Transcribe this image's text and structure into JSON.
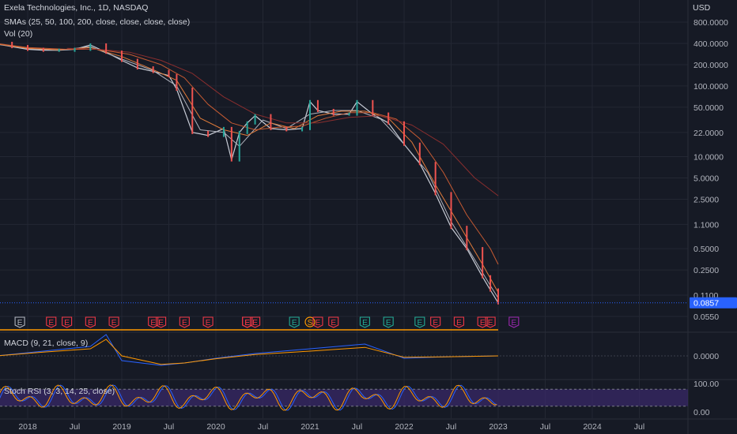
{
  "header": {
    "title": "Exela Technologies, Inc., 1D, NASDAQ",
    "sma_legend": "SMAs (25, 50, 100, 200, close, close, close, close)",
    "vol_legend": "Vol (20)",
    "currency": "USD"
  },
  "colors": {
    "background": "#161a25",
    "grid": "#232733",
    "price_line": "#c8ccd6",
    "sma25": "#b0b3bd",
    "sma50": "#e07b3a",
    "sma100": "#c55a32",
    "sma200": "#8a2e2e",
    "up_candle": "#26a69a",
    "down_candle": "#ef5350",
    "macd_line": "#2962ff",
    "signal_line": "#ff9800",
    "stoch_k": "#2962ff",
    "stoch_d": "#ff9800",
    "stoch_band": "#3b2a6b",
    "earnings_red": "#f23645",
    "earnings_green": "#22ab94",
    "earnings_orange": "#ff9800",
    "earnings_purple": "#9c27b0",
    "current_price_tag": "#2962ff"
  },
  "chart_data": [
    {
      "type": "line",
      "panel": "price",
      "title": "Exela Technologies, Inc., 1D, NASDAQ",
      "scale": "log",
      "ylabel": "USD",
      "y_ticks": [
        800,
        400,
        200,
        100,
        50,
        22,
        10,
        5,
        2.5,
        1.1,
        0.5,
        0.25,
        0.11,
        0.055
      ],
      "y_tick_labels": [
        "800.0000",
        "400.0000",
        "200.0000",
        "100.0000",
        "50.0000",
        "22.0000",
        "10.0000",
        "5.0000",
        "2.5000",
        "1.1000",
        "0.5000",
        "0.2500",
        "0.1100",
        "0.0550"
      ],
      "current_price": 0.0857,
      "current_price_label": "0.0857",
      "x_tick_labels": [
        "2018",
        "Jul",
        "2019",
        "Jul",
        "2020",
        "Jul",
        "2021",
        "Jul",
        "2022",
        "Jul",
        "2023",
        "Jul",
        "2024",
        "Jul"
      ],
      "x_tick_dates": [
        "2018-01",
        "2018-07",
        "2019-01",
        "2019-07",
        "2020-01",
        "2020-07",
        "2021-01",
        "2021-07",
        "2022-01",
        "2022-07",
        "2023-01",
        "2023-07",
        "2024-01",
        "2024-07"
      ],
      "series": [
        {
          "name": "Price",
          "x": [
            "2017-09",
            "2017-11",
            "2018-01",
            "2018-03",
            "2018-05",
            "2018-07",
            "2018-09",
            "2018-11",
            "2019-01",
            "2019-03",
            "2019-05",
            "2019-07",
            "2019-08",
            "2019-10",
            "2019-12",
            "2020-02",
            "2020-03",
            "2020-04",
            "2020-05",
            "2020-06",
            "2020-08",
            "2020-10",
            "2020-12",
            "2021-01",
            "2021-02",
            "2021-04",
            "2021-06",
            "2021-07",
            "2021-09",
            "2021-11",
            "2022-01",
            "2022-03",
            "2022-05",
            "2022-07",
            "2022-09",
            "2022-11",
            "2022-12",
            "2023-01"
          ],
          "values": [
            400,
            360,
            330,
            320,
            320,
            330,
            380,
            300,
            230,
            180,
            160,
            140,
            90,
            22,
            20,
            25,
            9,
            22,
            30,
            38,
            25,
            24,
            25,
            60,
            45,
            40,
            40,
            60,
            40,
            30,
            15,
            8,
            3,
            1,
            0.5,
            0.2,
            0.13,
            0.0857
          ]
        },
        {
          "name": "SMA 25",
          "x": [
            "2017-09",
            "2018-01",
            "2018-05",
            "2018-09",
            "2019-01",
            "2019-05",
            "2019-08",
            "2019-11",
            "2020-02",
            "2020-04",
            "2020-07",
            "2020-10",
            "2021-01",
            "2021-04",
            "2021-07",
            "2021-10",
            "2022-01",
            "2022-04",
            "2022-07",
            "2022-10",
            "2022-12",
            "2023-01"
          ],
          "values": [
            390,
            335,
            320,
            360,
            240,
            165,
            100,
            24,
            22,
            14,
            33,
            25,
            40,
            45,
            45,
            34,
            15,
            6,
            1.2,
            0.35,
            0.15,
            0.1
          ]
        },
        {
          "name": "SMA 50",
          "x": [
            "2017-09",
            "2018-01",
            "2018-05",
            "2018-09",
            "2019-01",
            "2019-05",
            "2019-08",
            "2019-11",
            "2020-02",
            "2020-05",
            "2020-08",
            "2020-11",
            "2021-02",
            "2021-05",
            "2021-08",
            "2021-11",
            "2022-02",
            "2022-05",
            "2022-08",
            "2022-11",
            "2023-01"
          ],
          "values": [
            395,
            340,
            325,
            350,
            260,
            170,
            120,
            35,
            24,
            20,
            30,
            25,
            38,
            44,
            44,
            35,
            16,
            4,
            1.1,
            0.3,
            0.12
          ]
        },
        {
          "name": "SMA 100",
          "x": [
            "2017-09",
            "2018-01",
            "2018-06",
            "2018-10",
            "2019-02",
            "2019-06",
            "2019-09",
            "2019-12",
            "2020-03",
            "2020-06",
            "2020-09",
            "2020-12",
            "2021-03",
            "2021-06",
            "2021-09",
            "2021-12",
            "2022-03",
            "2022-06",
            "2022-09",
            "2022-12",
            "2023-01"
          ],
          "values": [
            400,
            350,
            330,
            330,
            280,
            200,
            130,
            55,
            30,
            24,
            26,
            27,
            35,
            42,
            42,
            34,
            18,
            6,
            1.5,
            0.5,
            0.3
          ]
        },
        {
          "name": "SMA 200",
          "x": [
            "2018-06",
            "2018-10",
            "2019-02",
            "2019-06",
            "2019-10",
            "2020-02",
            "2020-06",
            "2020-10",
            "2021-02",
            "2021-06",
            "2021-10",
            "2022-02",
            "2022-06",
            "2022-10",
            "2023-01"
          ],
          "values": [
            340,
            330,
            300,
            230,
            150,
            70,
            40,
            30,
            30,
            36,
            38,
            28,
            15,
            5,
            2.8
          ]
        }
      ],
      "events": {
        "labels": [
          "E",
          "E",
          "E",
          "E",
          "E",
          "E",
          "E",
          "E",
          "E",
          "E",
          "E",
          "E",
          "E",
          "S",
          "E",
          "E",
          "E",
          "E",
          "E",
          "E",
          "E",
          "E",
          "E",
          "E"
        ],
        "dates": [
          "2017-12",
          "2018-04",
          "2018-06",
          "2018-09",
          "2018-12",
          "2019-05",
          "2019-06",
          "2019-09",
          "2019-12",
          "2020-05",
          "2020-05",
          "2020-06",
          "2020-11",
          "2021-01",
          "2021-02",
          "2021-04",
          "2021-08",
          "2021-11",
          "2022-03",
          "2022-05",
          "2022-08",
          "2022-11",
          "2022-12",
          "2023-03"
        ],
        "kinds": [
          "grey",
          "red",
          "red",
          "red",
          "red",
          "red",
          "red",
          "red",
          "red",
          "red",
          "red",
          "red",
          "green",
          "orange",
          "red",
          "red",
          "green",
          "green",
          "green",
          "red",
          "red",
          "red",
          "red",
          "purple"
        ]
      }
    },
    {
      "type": "line",
      "panel": "macd",
      "title": "MACD (9, 21, close, 9)",
      "y_tick_labels": [
        "0.0000"
      ],
      "series": [
        {
          "name": "MACD",
          "x": [
            "2017-09",
            "2018-03",
            "2018-09",
            "2018-11",
            "2019-01",
            "2019-06",
            "2019-09",
            "2020-01",
            "2020-06",
            "2021-01",
            "2021-08",
            "2022-01",
            "2022-06",
            "2023-01"
          ],
          "values": [
            0,
            10,
            20,
            45,
            -10,
            -20,
            -15,
            -5,
            5,
            15,
            25,
            -5,
            -2,
            0
          ]
        },
        {
          "name": "Signal",
          "x": [
            "2017-09",
            "2018-03",
            "2018-09",
            "2018-11",
            "2019-01",
            "2019-06",
            "2019-09",
            "2020-01",
            "2020-06",
            "2021-01",
            "2021-08",
            "2022-01",
            "2022-06",
            "2023-01"
          ],
          "values": [
            0,
            8,
            15,
            35,
            0,
            -18,
            -15,
            -6,
            3,
            10,
            18,
            -3,
            -2,
            0
          ]
        }
      ]
    },
    {
      "type": "line",
      "panel": "stoch_rsi",
      "title": "Stoch RSI (3, 3, 14, 25, close)",
      "y_tick_labels": [
        "100.00",
        "0.00"
      ],
      "bands": [
        20,
        80
      ],
      "ylim": [
        0,
        100
      ]
    }
  ]
}
